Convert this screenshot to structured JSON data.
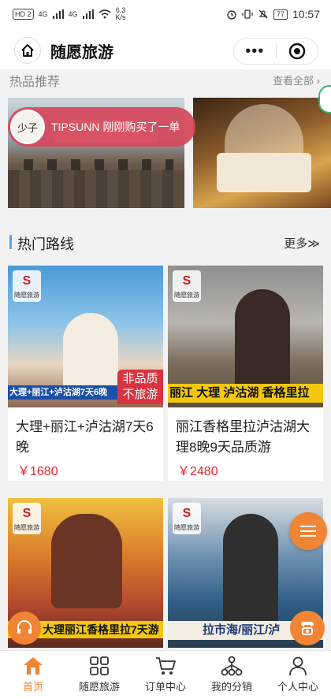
{
  "status_bar": {
    "hd_badge": "HD 2",
    "net_1": "4G",
    "net_2": "4G",
    "speed_value": "6.3",
    "speed_unit": "K/s",
    "battery": "77",
    "time": "10:57"
  },
  "nav": {
    "title": "随愿旅游",
    "home_icon": "home-icon",
    "more_icon": "more-dots-icon",
    "close_icon": "target-close-icon"
  },
  "hot": {
    "title": "热品推荐",
    "see_all": "查看全部 ›"
  },
  "toast": {
    "avatar_text": "少子",
    "message": "TIPSUNN 刚刚购买了一单"
  },
  "routes": {
    "title": "热门路线",
    "more": "更多≫"
  },
  "cards": [
    {
      "caption": "大理+丽江+泸沽湖7天6晚",
      "stamp_line1": "非品质",
      "stamp_line2": "不旅游",
      "name": "大理+丽江+泸沽湖7天6晚",
      "price": "￥1680"
    },
    {
      "caption": "丽江 大理 泸沽湖 香格里拉",
      "name": "丽江香格里拉泸沽湖大理8晚9天品质游",
      "price": "￥2480"
    },
    {
      "caption": "大理丽江香格里拉7天游"
    },
    {
      "caption": "拉市海/丽江/泸"
    }
  ],
  "tabs": [
    {
      "label": "首页",
      "icon": "home-icon"
    },
    {
      "label": "随愿旅游",
      "icon": "grid-icon"
    },
    {
      "label": "订单中心",
      "icon": "cart-icon"
    },
    {
      "label": "我的分销",
      "icon": "network-icon"
    },
    {
      "label": "个人中心",
      "icon": "person-icon"
    }
  ],
  "colors": {
    "accent": "#f08535",
    "price": "#e2242c",
    "toast": "#d6485b",
    "routes_bar": "#5aa7e8"
  }
}
